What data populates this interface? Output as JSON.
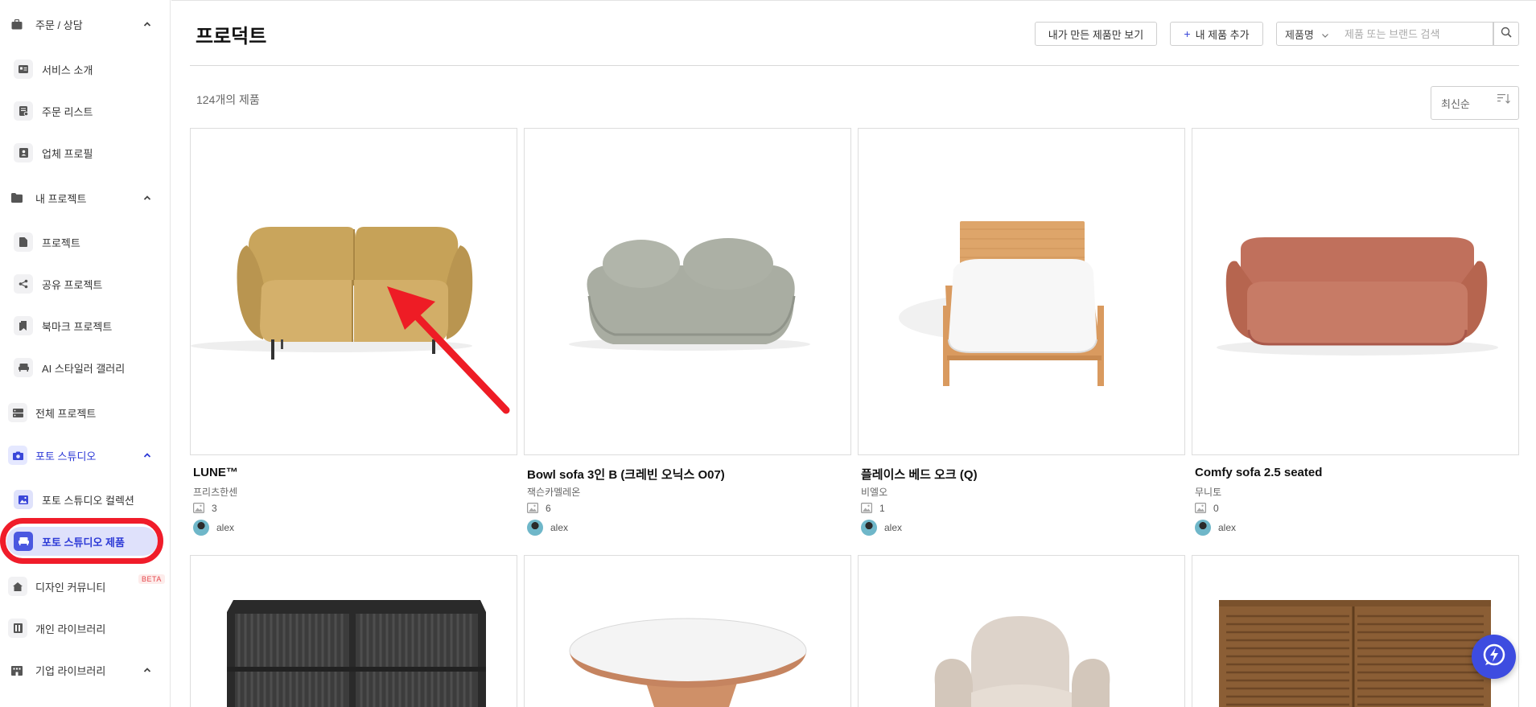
{
  "sidebar": {
    "groups": [
      {
        "label": "주문 / 상담"
      },
      {
        "label": "내 프로젝트"
      },
      {
        "label": "포토 스튜디오"
      },
      {
        "label": "기업 라이브러리"
      }
    ],
    "items": [
      {
        "label": "서비스 소개"
      },
      {
        "label": "주문 리스트"
      },
      {
        "label": "업체 프로필"
      },
      {
        "label": "프로젝트"
      },
      {
        "label": "공유 프로젝트"
      },
      {
        "label": "북마크 프로젝트"
      },
      {
        "label": "AI 스타일러 갤러리"
      },
      {
        "label": "전체 프로젝트"
      },
      {
        "label": "포토 스튜디오 컬렉션"
      },
      {
        "label": "포토 스튜디오 제품"
      },
      {
        "label": "디자인 커뮤니티"
      },
      {
        "label": "개인 라이브러리"
      }
    ],
    "beta_badge": "BETA"
  },
  "header": {
    "title": "프로덕트",
    "mine_button": "내가 만든 제품만 보기",
    "add_button": "내 제품 추가",
    "add_plus": "+",
    "search_field": "제품명",
    "search_placeholder": "제품 또는 브랜드 검색"
  },
  "list": {
    "count": "124개의 제품",
    "sort": "최신순"
  },
  "products": [
    {
      "name": "LUNE™",
      "brand": "프리츠한센",
      "images": "3",
      "user": "alex"
    },
    {
      "name": "Bowl sofa 3인 B (크레빈 오닉스 O07)",
      "brand": "잭슨카멜레온",
      "images": "6",
      "user": "alex"
    },
    {
      "name": "플레이스 베드 오크 (Q)",
      "brand": "비엘오",
      "images": "1",
      "user": "alex"
    },
    {
      "name": "Comfy sofa 2.5 seated",
      "brand": "무니토",
      "images": "0",
      "user": "alex"
    }
  ],
  "colors": {
    "accent": "#3d4ce0",
    "highlight_ring": "#f01c2a",
    "active_pill": "#dfe1fb"
  }
}
